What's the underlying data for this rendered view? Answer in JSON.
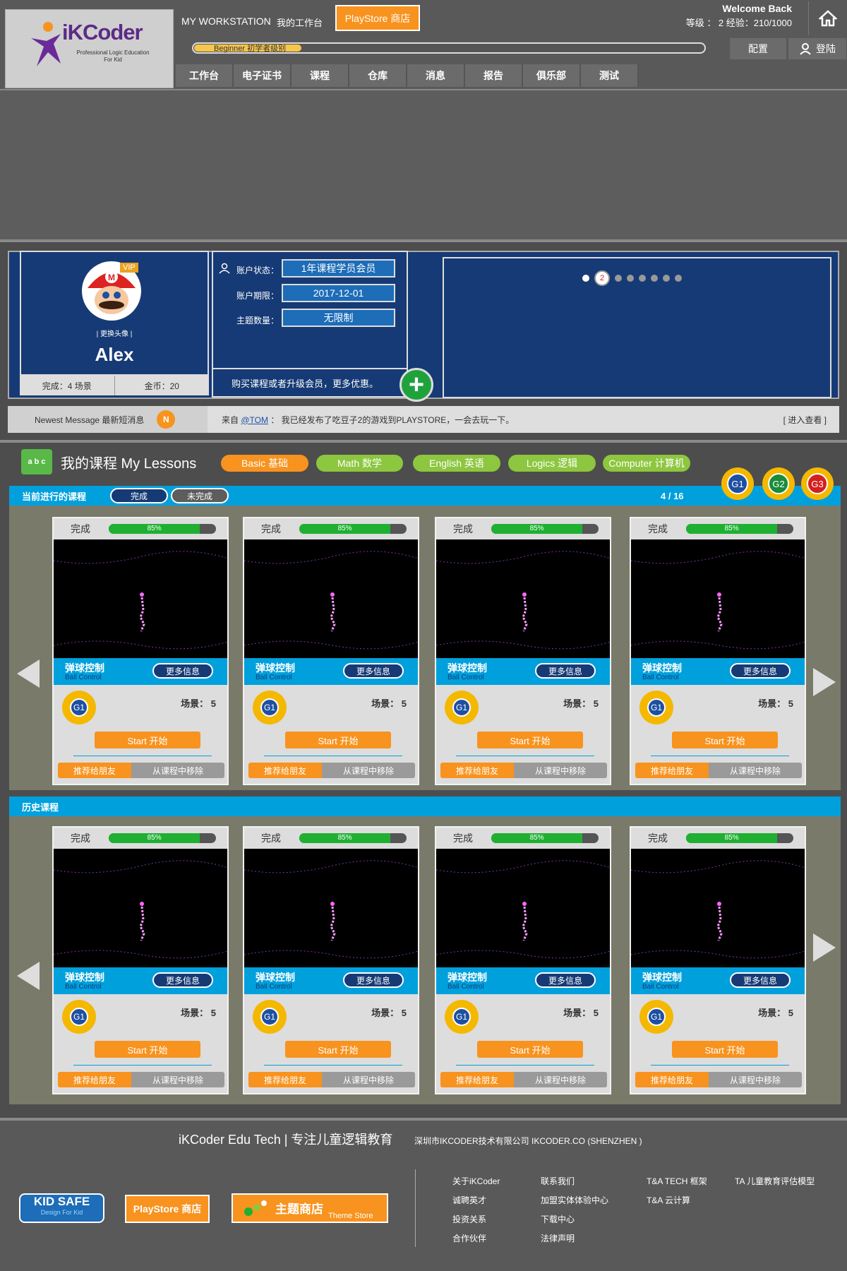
{
  "header": {
    "logo_text": "iKCoder",
    "logo_sub": "Professional Logic Education For Kid",
    "workstation_en": "MY WORKSTATION",
    "workstation_cn": "我的工作台",
    "playstore": "PlayStore 商店",
    "welcome": "Welcome Back",
    "level_text": "等级 ： 2  经验：210/1000",
    "level_bar_label": "Beginner 初学者级别",
    "level_progress_percent": 21,
    "config": "配置",
    "login": "登陆",
    "nav": [
      "工作台",
      "电子证书",
      "课程",
      "仓库",
      "消息",
      "报告",
      "俱乐部",
      "测试"
    ]
  },
  "profile": {
    "vip": "VIP",
    "change_avatar": "| 更换头像 |",
    "name": "Alex",
    "completed": "完成：4 场景",
    "coins": "金币：20"
  },
  "account": {
    "status_label": "账户状态：",
    "status_value": "1年课程学员会员",
    "expiry_label": "账户期限：",
    "expiry_value": "2017-12-01",
    "themes_label": "主题数量：",
    "themes_value": "无限制",
    "promo": "购买课程或者升级会员，更多优惠。",
    "plus": "+"
  },
  "slider": {
    "current": "2",
    "total_dots": 8,
    "active_index": 1
  },
  "message": {
    "label": "Newest Message 最新短消息",
    "badge": "N",
    "from_prefix": "来自",
    "from_user": "@TOM",
    "text": "：  我已经发布了吃豆子2的游戏到PLAYSTORE，一会去玩一下。",
    "more": "[ 进入查看 ]"
  },
  "lessons": {
    "icon_text": "a b c",
    "title": "我的课程  My Lessons",
    "categories": [
      "Basic  基础",
      "Math    数学",
      "English  英语",
      "Logics    逻辑",
      "Computer 计算机"
    ],
    "grades": [
      "G1",
      "G2",
      "G3"
    ],
    "current_title": "当前进行的课程",
    "toggle_done": "完成",
    "toggle_undone": "未完成",
    "page": "4  /  16",
    "history_title": "历史课程"
  },
  "cards": {
    "done_label": "完成",
    "progress": "85%",
    "progress_value": 85,
    "title": "弹球控制",
    "subtitle": "Ball Control",
    "more": "更多信息",
    "grade": "G1",
    "scene": "场景：  5",
    "start": "Start  开始",
    "recommend": "推荐给朋友",
    "remove": "从课程中移除"
  },
  "footer": {
    "brand": "iKCoder Edu Tech | 专注儿童逻辑教育",
    "company": "深圳市IKCODER技术有限公司 IKCODER.CO (SHENZHEN )",
    "kid_safe": "KID SAFE",
    "kid_safe_sub": "Design For Kid",
    "playstore": "PlayStore 商店",
    "theme_store": "主题商店",
    "theme_store_en": "Theme Store",
    "col1": [
      "关于iKCoder",
      "诚聘英才",
      "投资关系",
      "合作伙伴"
    ],
    "col2": [
      "联系我们",
      "加盟实体体验中心",
      "下载中心",
      "法律声明"
    ],
    "col3": [
      "T&A TECH 框架",
      "T&A 云计算"
    ],
    "col4": [
      "TA 儿童教育评估模型"
    ]
  }
}
